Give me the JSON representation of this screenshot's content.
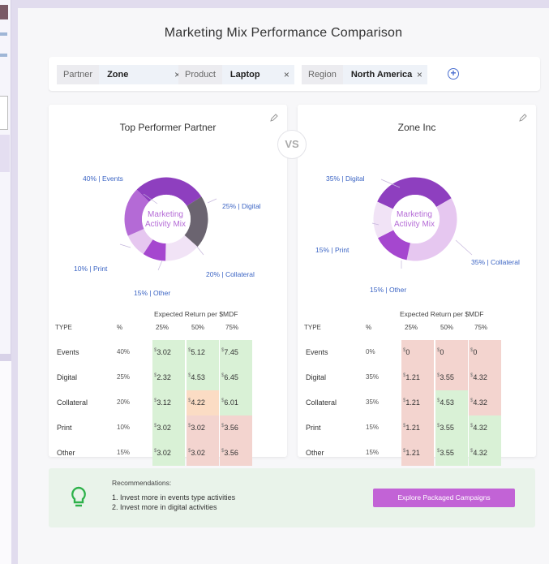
{
  "title": "Marketing Mix Performance Comparison",
  "filters": [
    {
      "key": "Partner",
      "value": "Zone"
    },
    {
      "key": "Product",
      "value": "Laptop"
    },
    {
      "key": "Region",
      "value": "North America"
    }
  ],
  "remove_glyph": "×",
  "add_glyph": "+",
  "vs_label": "VS",
  "colors": {
    "accent": "#c263d6",
    "donut_dark": "#8e3fbf",
    "donut_mid": "#b46ad6",
    "donut_light": "#e6c7f0",
    "donut_lighter": "#f1e3f6",
    "donut_gray": "#6b6470",
    "positive_cell": "#d9f1d6",
    "negative_cell": "#f3d4cf",
    "neutral_cell": "#fbdcc4"
  },
  "table_header": {
    "expected_return": "Expected Return per $MDF",
    "type": "TYPE",
    "pct": "%",
    "p25": "25%",
    "p50": "50%",
    "p75": "75%"
  },
  "cards": {
    "left": {
      "title": "Top Performer Partner",
      "center_line1": "Marketing",
      "center_line2": "Activity Mix",
      "segment_labels": {
        "events": "40% | Events",
        "digital": "25% | Digital",
        "collateral": "20% | Collateral",
        "other": "15% | Other",
        "print": "10% | Print"
      },
      "rows": [
        {
          "type": "Events",
          "pct": "40%",
          "v25": "3.02",
          "v50": "5.12",
          "v75": "7.45",
          "c25": "g",
          "c50": "g",
          "c75": "g"
        },
        {
          "type": "Digital",
          "pct": "25%",
          "v25": "2.32",
          "v50": "4.53",
          "v75": "6.45",
          "c25": "g",
          "c50": "g",
          "c75": "g"
        },
        {
          "type": "Collateral",
          "pct": "20%",
          "v25": "3.12",
          "v50": "4.22",
          "v75": "6.01",
          "c25": "g",
          "c50": "o",
          "c75": "g"
        },
        {
          "type": "Print",
          "pct": "10%",
          "v25": "3.02",
          "v50": "3.02",
          "v75": "3.56",
          "c25": "g",
          "c50": "r",
          "c75": "r"
        },
        {
          "type": "Other",
          "pct": "15%",
          "v25": "3.02",
          "v50": "3.02",
          "v75": "3.56",
          "c25": "g",
          "c50": "r",
          "c75": "r"
        }
      ]
    },
    "right": {
      "title": "Zone Inc",
      "center_line1": "Marketing",
      "center_line2": "Activity Mix",
      "segment_labels": {
        "digital": "35% | Digital",
        "print": "15% | Print",
        "collateral": "35% | Collateral",
        "other": "15% | Other"
      },
      "rows": [
        {
          "type": "Events",
          "pct": "0%",
          "v25": "0",
          "v50": "0",
          "v75": "0",
          "c25": "r",
          "c50": "r",
          "c75": "r"
        },
        {
          "type": "Digital",
          "pct": "35%",
          "v25": "1.21",
          "v50": "3.55",
          "v75": "4.32",
          "c25": "r",
          "c50": "r",
          "c75": "r"
        },
        {
          "type": "Collateral",
          "pct": "35%",
          "v25": "1.21",
          "v50": "4.53",
          "v75": "4.32",
          "c25": "r",
          "c50": "g",
          "c75": "r"
        },
        {
          "type": "Print",
          "pct": "15%",
          "v25": "1.21",
          "v50": "3.55",
          "v75": "4.32",
          "c25": "r",
          "c50": "g",
          "c75": "g"
        },
        {
          "type": "Other",
          "pct": "15%",
          "v25": "1.21",
          "v50": "3.55",
          "v75": "4.32",
          "c25": "r",
          "c50": "g",
          "c75": "g"
        }
      ]
    }
  },
  "recommendations": {
    "heading": "Recommendations:",
    "lines": [
      "1. Invest more in events type activities",
      "2. Invest more in digital activities"
    ],
    "button_label": "Explore Packaged Campaigns"
  },
  "currency_symbol": "$",
  "icons": {
    "edit": "pencil-icon",
    "bulb": "lightbulb-icon",
    "add": "add-circle-icon",
    "close": "close-icon"
  }
}
